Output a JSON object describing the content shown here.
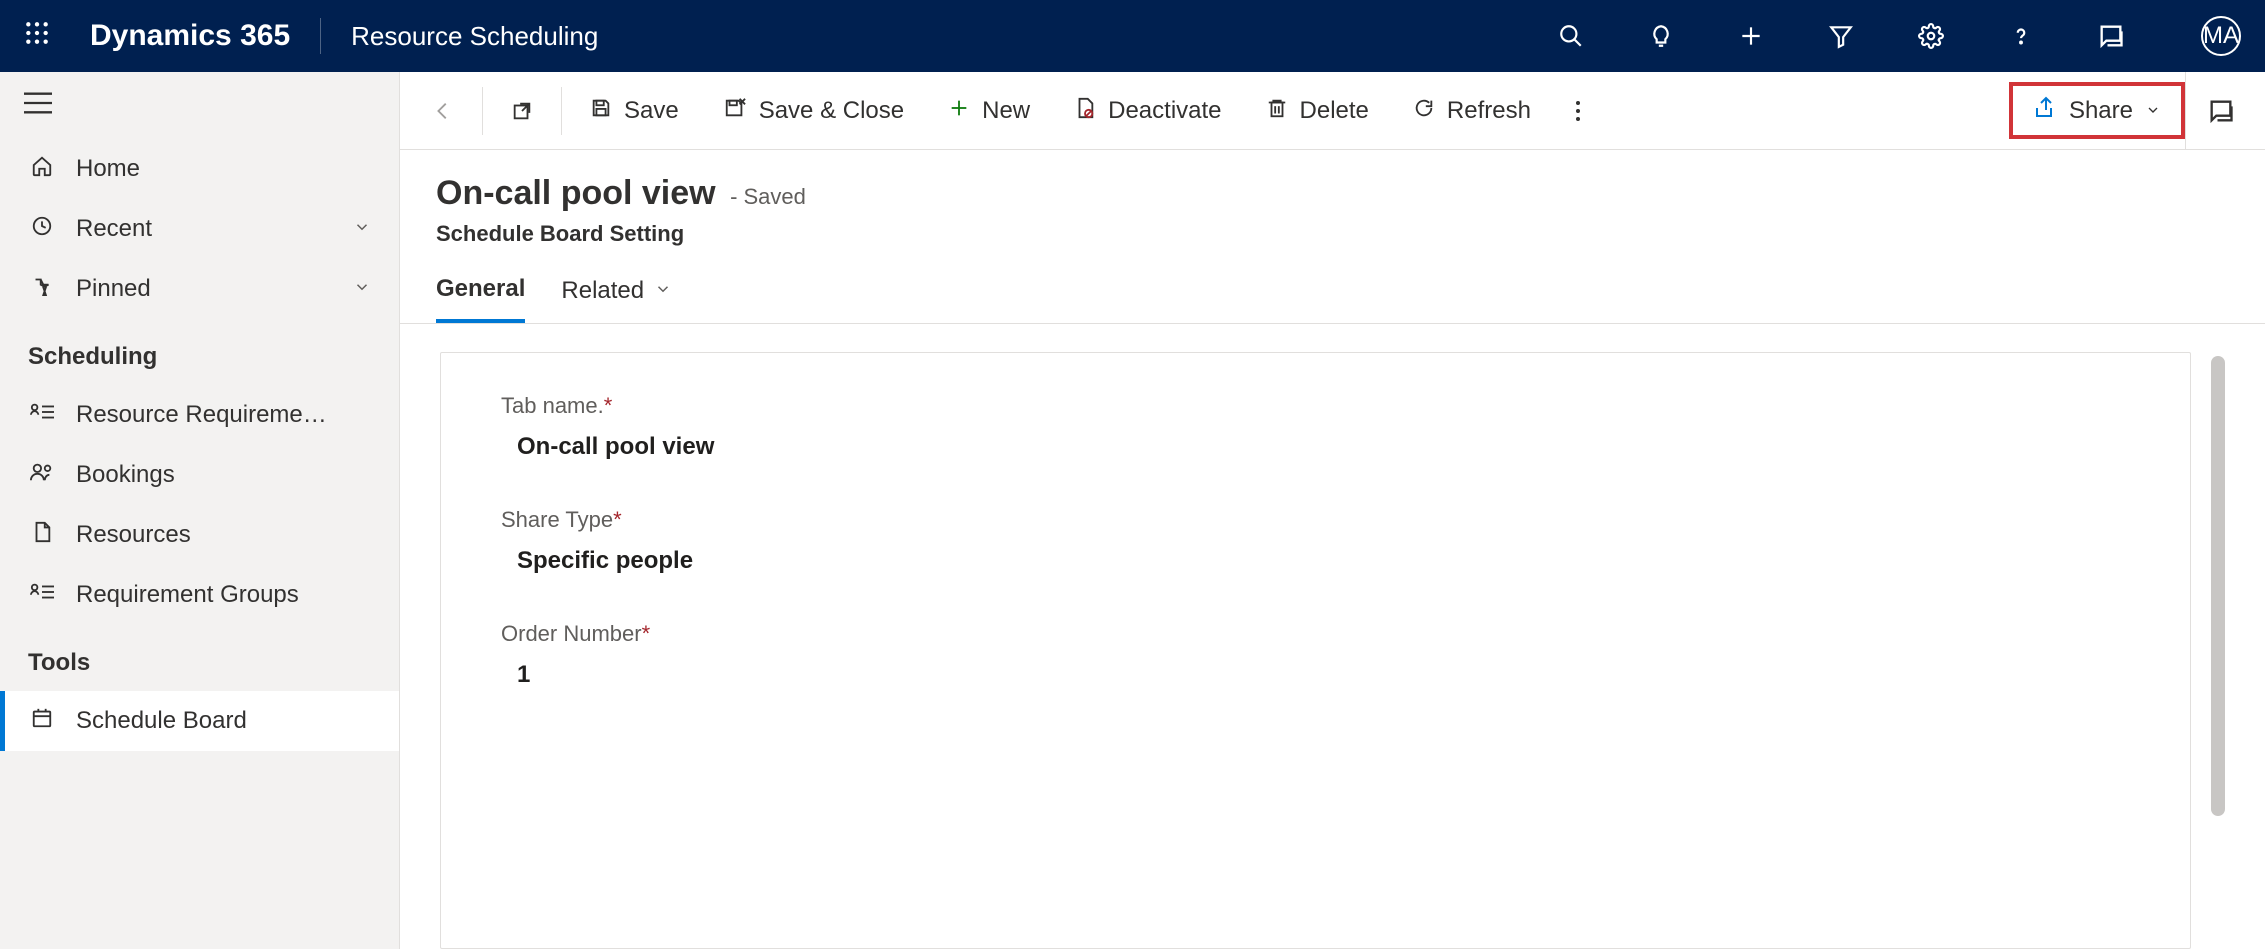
{
  "topbar": {
    "brand": "Dynamics 365",
    "module": "Resource Scheduling",
    "avatar_initials": "MA"
  },
  "sidebar": {
    "home": "Home",
    "recent": "Recent",
    "pinned": "Pinned",
    "group_scheduling": "Scheduling",
    "resource_requirements": "Resource Requireme…",
    "bookings": "Bookings",
    "resources": "Resources",
    "requirement_groups": "Requirement Groups",
    "group_tools": "Tools",
    "schedule_board": "Schedule Board"
  },
  "commands": {
    "save": "Save",
    "save_close": "Save & Close",
    "new": "New",
    "deactivate": "Deactivate",
    "delete": "Delete",
    "refresh": "Refresh",
    "share": "Share"
  },
  "record": {
    "title": "On-call pool view",
    "status": "- Saved",
    "subtitle": "Schedule Board Setting"
  },
  "tabs": {
    "general": "General",
    "related": "Related"
  },
  "fields": {
    "tab_name_label": "Tab name.",
    "tab_name_value": "On-call pool view",
    "share_type_label": "Share Type",
    "share_type_value": "Specific people",
    "order_number_label": "Order Number",
    "order_number_value": "1"
  }
}
